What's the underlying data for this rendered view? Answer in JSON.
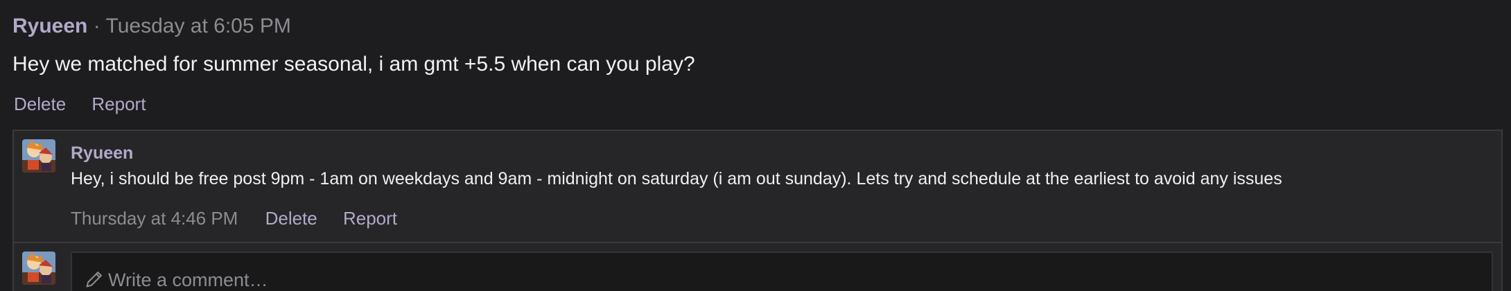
{
  "post": {
    "author": "Ryueen",
    "separator": " · ",
    "timestamp": "Tuesday at 6:05 PM",
    "body": "Hey we matched for summer seasonal, i am gmt +5.5 when can you play?",
    "actions": {
      "delete_label": "Delete",
      "report_label": "Report"
    }
  },
  "comments": [
    {
      "author": "Ryueen",
      "text": "Hey, i should be free post 9pm - 1am on weekdays and 9am - midnight on saturday (i am out sunday). Lets try and schedule at the earliest to avoid any issues",
      "timestamp": "Thursday at 4:46 PM",
      "delete_label": "Delete",
      "report_label": "Report"
    }
  ],
  "new_comment": {
    "placeholder": "Write a comment…",
    "icon": "pencil-icon"
  },
  "colors": {
    "background": "#1d1d1f",
    "panel": "#262628",
    "accent": "#b3a9c9",
    "muted": "#8c8c92"
  }
}
